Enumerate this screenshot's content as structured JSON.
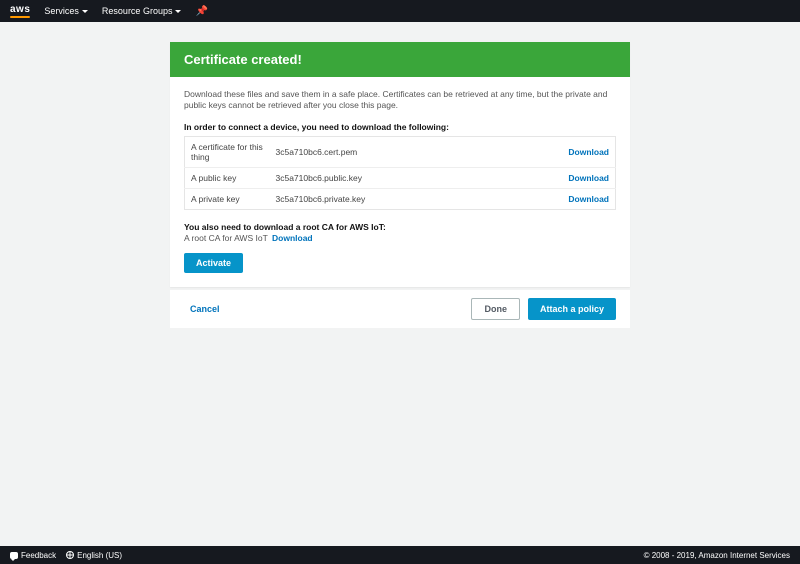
{
  "navbar": {
    "logo": "aws",
    "services": "Services",
    "resource_groups": "Resource Groups",
    "pin_icon": "📌"
  },
  "banner": {
    "title": "Certificate created!"
  },
  "body": {
    "notice": "Download these files and save them in a safe place. Certificates can be retrieved at any time, but the private and public keys cannot be retrieved after you close this page.",
    "instruction": "In order to connect a device, you need to download the following:",
    "download_label": "Download"
  },
  "files": [
    {
      "desc": "A certificate for this thing",
      "name": "3c5a710bc6.cert.pem"
    },
    {
      "desc": "A public key",
      "name": "3c5a710bc6.public.key"
    },
    {
      "desc": "A private key",
      "name": "3c5a710bc6.private.key"
    }
  ],
  "root_ca": {
    "header": "You also need to download a root CA for AWS IoT:",
    "line_prefix": "A root CA for AWS IoT",
    "download": "Download"
  },
  "buttons": {
    "activate": "Activate",
    "cancel": "Cancel",
    "done": "Done",
    "attach_policy": "Attach a policy"
  },
  "statusbar": {
    "feedback": "Feedback",
    "language": "English (US)",
    "copyright": "© 2008 - 2019, Amazon Internet Services"
  }
}
